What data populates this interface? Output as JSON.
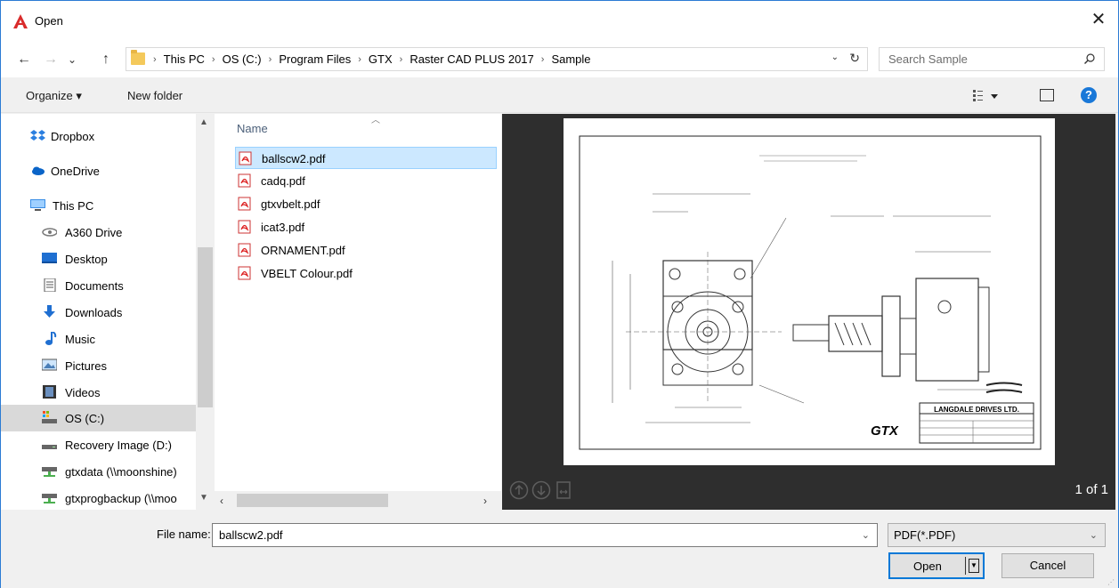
{
  "title": "Open",
  "close_glyph": "✕",
  "nav": {
    "back": "←",
    "forward": "→",
    "recent": "⌄",
    "up": "↑"
  },
  "address": {
    "start_sep": "›",
    "sep": "›",
    "crumbs": [
      "This PC",
      "OS (C:)",
      "Program Files",
      "GTX",
      "Raster CAD PLUS 2017",
      "Sample"
    ],
    "dropdown": "⌄",
    "refresh": "↻"
  },
  "search": {
    "placeholder": "Search Sample"
  },
  "toolbar": {
    "organize": "Organize ▾",
    "new_folder": "New folder",
    "help": "?"
  },
  "sidebar": {
    "items": [
      {
        "label": "Dropbox",
        "icon": "dropbox-icon"
      },
      {
        "label": "OneDrive",
        "icon": "onedrive-icon"
      },
      {
        "label": "This PC",
        "icon": "computer-icon"
      },
      {
        "label": "A360 Drive",
        "icon": "a360-drive-icon"
      },
      {
        "label": "Desktop",
        "icon": "desktop-icon"
      },
      {
        "label": "Documents",
        "icon": "documents-icon"
      },
      {
        "label": "Downloads",
        "icon": "downloads-icon"
      },
      {
        "label": "Music",
        "icon": "music-icon"
      },
      {
        "label": "Pictures",
        "icon": "pictures-icon"
      },
      {
        "label": "Videos",
        "icon": "videos-icon"
      },
      {
        "label": "OS (C:)",
        "icon": "drive-icon",
        "selected": true
      },
      {
        "label": "Recovery Image (D:)",
        "icon": "drive-icon"
      },
      {
        "label": "gtxdata (\\\\moonshine)",
        "icon": "network-drive-icon"
      },
      {
        "label": "gtxprogbackup (\\\\moo",
        "icon": "network-drive-icon"
      }
    ]
  },
  "files": {
    "column_header": "Name",
    "items": [
      {
        "name": "ballscw2.pdf",
        "selected": true
      },
      {
        "name": "cadq.pdf"
      },
      {
        "name": "gtxvbelt.pdf"
      },
      {
        "name": "icat3.pdf"
      },
      {
        "name": "ORNAMENT.pdf"
      },
      {
        "name": "VBELT Colour.pdf"
      }
    ]
  },
  "preview": {
    "page_count": "1 of 1",
    "drawing": {
      "company": "LANGDALE DRIVES LTD.",
      "logo": "GTX"
    }
  },
  "footer": {
    "file_name_label": "File name:",
    "file_name_value": "ballscw2.pdf",
    "filter_value": "PDF(*.PDF)",
    "open_label": "Open",
    "cancel_label": "Cancel"
  },
  "colors": {
    "accent": "#0078d7",
    "selection": "#cce8ff",
    "preview_bg": "#2e2e2e",
    "autocad_red": "#d92b2b"
  }
}
